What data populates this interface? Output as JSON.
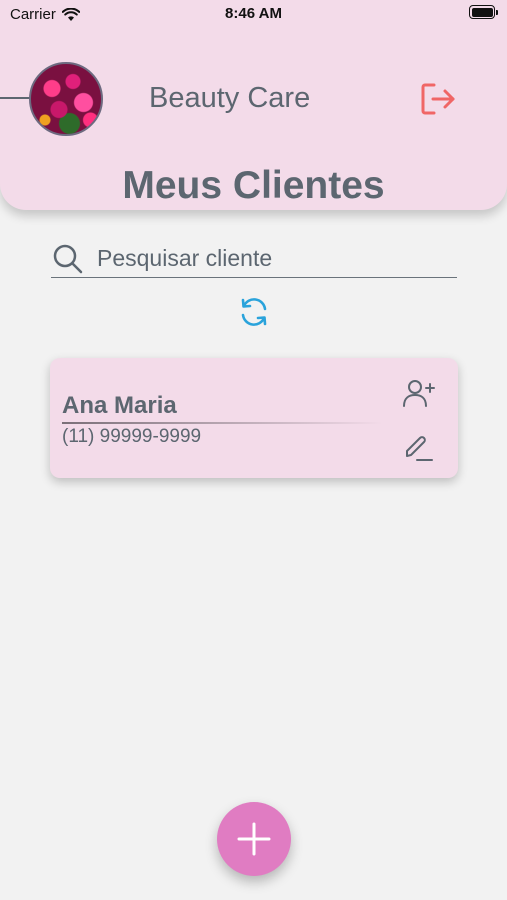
{
  "status_bar": {
    "carrier": "Carrier",
    "time": "8:46 AM"
  },
  "header": {
    "app_title": "Beauty Care",
    "page_title": "Meus Clientes"
  },
  "search": {
    "placeholder": "Pesquisar cliente",
    "value": ""
  },
  "clients": [
    {
      "name": "Ana Maria",
      "phone": "(11) 99999-9999"
    }
  ],
  "colors": {
    "header_bg": "#f3dbe9",
    "card_bg": "#f3dbe9",
    "text": "#5c6670",
    "logout": "#f06666",
    "refresh": "#2aa3db",
    "fab": "#e07cc2"
  },
  "icons": [
    "wifi-icon",
    "battery-icon",
    "logout-icon",
    "search-icon",
    "refresh-icon",
    "add-user-icon",
    "edit-icon",
    "plus-icon"
  ]
}
